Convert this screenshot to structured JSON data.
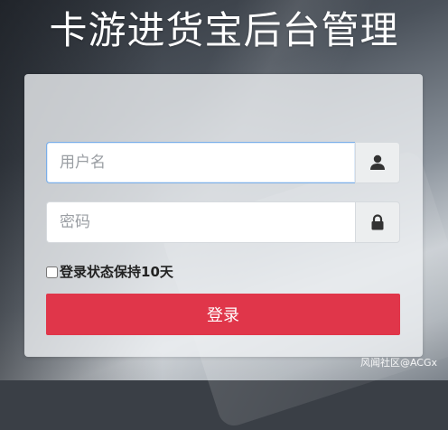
{
  "page": {
    "title": "卡游进货宝后台管理"
  },
  "login_form": {
    "username": {
      "placeholder": "用户名",
      "value": "",
      "icon": "user-icon"
    },
    "password": {
      "placeholder": "密码",
      "value": "",
      "icon": "lock-icon"
    },
    "remember": {
      "label": "登录状态保持10天",
      "checked": false
    },
    "submit_label": "登录"
  },
  "watermark": "风闻社区@ACGx",
  "colors": {
    "primary_button": "#e0364a",
    "focus_border": "#7aaee8"
  }
}
